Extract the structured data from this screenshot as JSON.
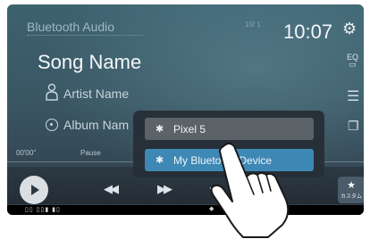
{
  "header": {
    "source_label": "Bluetooth Audio",
    "temperature": "10/ 1",
    "clock": "10:07",
    "settings_icon": "gear-icon"
  },
  "track": {
    "song": "Song Name",
    "artist": "Artist Name",
    "album": "Album Nam"
  },
  "side_icons": {
    "eq_label": "EQ",
    "list_icon": "list-icon",
    "copy_icon": "copy-icon"
  },
  "playback": {
    "elapsed": "00'00\"",
    "state": "Pause",
    "progress": 0
  },
  "controls": {
    "play_icon": "play-icon",
    "prev_icon": "previous-track-icon",
    "next_icon": "next-track-icon",
    "repeat_icon": "repeat-icon",
    "shuffle_icon": "shuffle-icon",
    "custom_label": "カスタム"
  },
  "device_popup": {
    "options": [
      {
        "label": "Pixel 5",
        "selected": false
      },
      {
        "label": "My Bluetooth Device",
        "selected": true
      }
    ]
  },
  "colors": {
    "selected_option": "#3e88b5",
    "unselected_option": "#5b6268",
    "background_top": "#3d6270",
    "background_bottom": "#2f3c49"
  }
}
